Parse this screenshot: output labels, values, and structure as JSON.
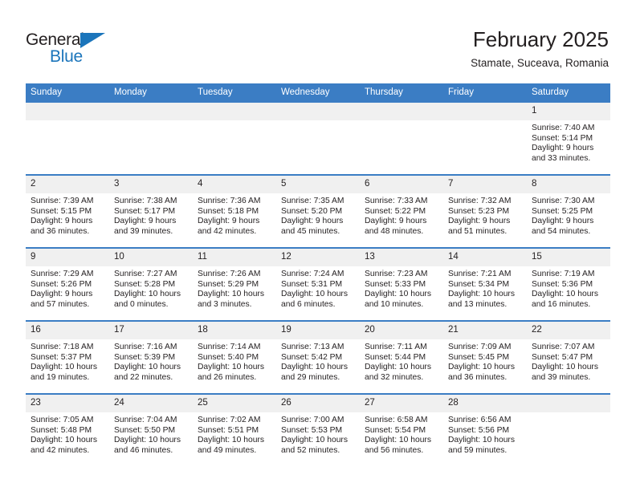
{
  "brand": {
    "name_part1": "General",
    "name_part2": "Blue",
    "accent_color": "#1b75bb"
  },
  "header": {
    "title": "February 2025",
    "subtitle": "Stamate, Suceava, Romania",
    "header_bg_color": "#3b7dc4",
    "daynum_bg_color": "#f0f0f0"
  },
  "weekday_headers": [
    "Sunday",
    "Monday",
    "Tuesday",
    "Wednesday",
    "Thursday",
    "Friday",
    "Saturday"
  ],
  "weeks": [
    [
      {
        "day": "",
        "sunrise": "",
        "sunset": "",
        "daylight_line1": "",
        "daylight_line2": ""
      },
      {
        "day": "",
        "sunrise": "",
        "sunset": "",
        "daylight_line1": "",
        "daylight_line2": ""
      },
      {
        "day": "",
        "sunrise": "",
        "sunset": "",
        "daylight_line1": "",
        "daylight_line2": ""
      },
      {
        "day": "",
        "sunrise": "",
        "sunset": "",
        "daylight_line1": "",
        "daylight_line2": ""
      },
      {
        "day": "",
        "sunrise": "",
        "sunset": "",
        "daylight_line1": "",
        "daylight_line2": ""
      },
      {
        "day": "",
        "sunrise": "",
        "sunset": "",
        "daylight_line1": "",
        "daylight_line2": ""
      },
      {
        "day": "1",
        "sunrise": "Sunrise: 7:40 AM",
        "sunset": "Sunset: 5:14 PM",
        "daylight_line1": "Daylight: 9 hours",
        "daylight_line2": "and 33 minutes."
      }
    ],
    [
      {
        "day": "2",
        "sunrise": "Sunrise: 7:39 AM",
        "sunset": "Sunset: 5:15 PM",
        "daylight_line1": "Daylight: 9 hours",
        "daylight_line2": "and 36 minutes."
      },
      {
        "day": "3",
        "sunrise": "Sunrise: 7:38 AM",
        "sunset": "Sunset: 5:17 PM",
        "daylight_line1": "Daylight: 9 hours",
        "daylight_line2": "and 39 minutes."
      },
      {
        "day": "4",
        "sunrise": "Sunrise: 7:36 AM",
        "sunset": "Sunset: 5:18 PM",
        "daylight_line1": "Daylight: 9 hours",
        "daylight_line2": "and 42 minutes."
      },
      {
        "day": "5",
        "sunrise": "Sunrise: 7:35 AM",
        "sunset": "Sunset: 5:20 PM",
        "daylight_line1": "Daylight: 9 hours",
        "daylight_line2": "and 45 minutes."
      },
      {
        "day": "6",
        "sunrise": "Sunrise: 7:33 AM",
        "sunset": "Sunset: 5:22 PM",
        "daylight_line1": "Daylight: 9 hours",
        "daylight_line2": "and 48 minutes."
      },
      {
        "day": "7",
        "sunrise": "Sunrise: 7:32 AM",
        "sunset": "Sunset: 5:23 PM",
        "daylight_line1": "Daylight: 9 hours",
        "daylight_line2": "and 51 minutes."
      },
      {
        "day": "8",
        "sunrise": "Sunrise: 7:30 AM",
        "sunset": "Sunset: 5:25 PM",
        "daylight_line1": "Daylight: 9 hours",
        "daylight_line2": "and 54 minutes."
      }
    ],
    [
      {
        "day": "9",
        "sunrise": "Sunrise: 7:29 AM",
        "sunset": "Sunset: 5:26 PM",
        "daylight_line1": "Daylight: 9 hours",
        "daylight_line2": "and 57 minutes."
      },
      {
        "day": "10",
        "sunrise": "Sunrise: 7:27 AM",
        "sunset": "Sunset: 5:28 PM",
        "daylight_line1": "Daylight: 10 hours",
        "daylight_line2": "and 0 minutes."
      },
      {
        "day": "11",
        "sunrise": "Sunrise: 7:26 AM",
        "sunset": "Sunset: 5:29 PM",
        "daylight_line1": "Daylight: 10 hours",
        "daylight_line2": "and 3 minutes."
      },
      {
        "day": "12",
        "sunrise": "Sunrise: 7:24 AM",
        "sunset": "Sunset: 5:31 PM",
        "daylight_line1": "Daylight: 10 hours",
        "daylight_line2": "and 6 minutes."
      },
      {
        "day": "13",
        "sunrise": "Sunrise: 7:23 AM",
        "sunset": "Sunset: 5:33 PM",
        "daylight_line1": "Daylight: 10 hours",
        "daylight_line2": "and 10 minutes."
      },
      {
        "day": "14",
        "sunrise": "Sunrise: 7:21 AM",
        "sunset": "Sunset: 5:34 PM",
        "daylight_line1": "Daylight: 10 hours",
        "daylight_line2": "and 13 minutes."
      },
      {
        "day": "15",
        "sunrise": "Sunrise: 7:19 AM",
        "sunset": "Sunset: 5:36 PM",
        "daylight_line1": "Daylight: 10 hours",
        "daylight_line2": "and 16 minutes."
      }
    ],
    [
      {
        "day": "16",
        "sunrise": "Sunrise: 7:18 AM",
        "sunset": "Sunset: 5:37 PM",
        "daylight_line1": "Daylight: 10 hours",
        "daylight_line2": "and 19 minutes."
      },
      {
        "day": "17",
        "sunrise": "Sunrise: 7:16 AM",
        "sunset": "Sunset: 5:39 PM",
        "daylight_line1": "Daylight: 10 hours",
        "daylight_line2": "and 22 minutes."
      },
      {
        "day": "18",
        "sunrise": "Sunrise: 7:14 AM",
        "sunset": "Sunset: 5:40 PM",
        "daylight_line1": "Daylight: 10 hours",
        "daylight_line2": "and 26 minutes."
      },
      {
        "day": "19",
        "sunrise": "Sunrise: 7:13 AM",
        "sunset": "Sunset: 5:42 PM",
        "daylight_line1": "Daylight: 10 hours",
        "daylight_line2": "and 29 minutes."
      },
      {
        "day": "20",
        "sunrise": "Sunrise: 7:11 AM",
        "sunset": "Sunset: 5:44 PM",
        "daylight_line1": "Daylight: 10 hours",
        "daylight_line2": "and 32 minutes."
      },
      {
        "day": "21",
        "sunrise": "Sunrise: 7:09 AM",
        "sunset": "Sunset: 5:45 PM",
        "daylight_line1": "Daylight: 10 hours",
        "daylight_line2": "and 36 minutes."
      },
      {
        "day": "22",
        "sunrise": "Sunrise: 7:07 AM",
        "sunset": "Sunset: 5:47 PM",
        "daylight_line1": "Daylight: 10 hours",
        "daylight_line2": "and 39 minutes."
      }
    ],
    [
      {
        "day": "23",
        "sunrise": "Sunrise: 7:05 AM",
        "sunset": "Sunset: 5:48 PM",
        "daylight_line1": "Daylight: 10 hours",
        "daylight_line2": "and 42 minutes."
      },
      {
        "day": "24",
        "sunrise": "Sunrise: 7:04 AM",
        "sunset": "Sunset: 5:50 PM",
        "daylight_line1": "Daylight: 10 hours",
        "daylight_line2": "and 46 minutes."
      },
      {
        "day": "25",
        "sunrise": "Sunrise: 7:02 AM",
        "sunset": "Sunset: 5:51 PM",
        "daylight_line1": "Daylight: 10 hours",
        "daylight_line2": "and 49 minutes."
      },
      {
        "day": "26",
        "sunrise": "Sunrise: 7:00 AM",
        "sunset": "Sunset: 5:53 PM",
        "daylight_line1": "Daylight: 10 hours",
        "daylight_line2": "and 52 minutes."
      },
      {
        "day": "27",
        "sunrise": "Sunrise: 6:58 AM",
        "sunset": "Sunset: 5:54 PM",
        "daylight_line1": "Daylight: 10 hours",
        "daylight_line2": "and 56 minutes."
      },
      {
        "day": "28",
        "sunrise": "Sunrise: 6:56 AM",
        "sunset": "Sunset: 5:56 PM",
        "daylight_line1": "Daylight: 10 hours",
        "daylight_line2": "and 59 minutes."
      },
      {
        "day": "",
        "sunrise": "",
        "sunset": "",
        "daylight_line1": "",
        "daylight_line2": ""
      }
    ]
  ]
}
